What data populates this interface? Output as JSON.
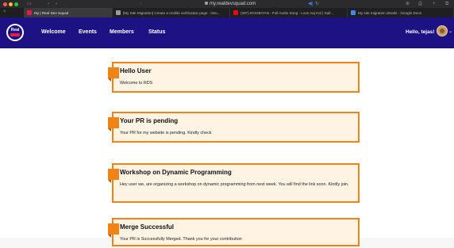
{
  "browser": {
    "url": "my.realdevsquad.com",
    "controls": [
      "‹",
      "›"
    ],
    "tabs": [
      {
        "label": "My | Real Dev Squad",
        "fav_color": "#e11d48"
      },
      {
        "label": "[My Site Migration] Create a mobile verification page - issu...",
        "fav_color": "#9a9a9e"
      },
      {
        "label": "(397) DOOBIYAN - Full Audio Song - Love Aaj Kal | Saif...",
        "fav_color": "#ff0000"
      },
      {
        "label": "My site migration details - Google Docs",
        "fav_color": "#4285f4"
      }
    ],
    "right_icons": [
      "⊕",
      "⎙",
      "+",
      "⧉"
    ]
  },
  "navbar": {
    "logo_text": "Real",
    "links": [
      "Welcome",
      "Events",
      "Members",
      "Status"
    ],
    "greeting": "Hello, tejas!",
    "accent": "#1d1283"
  },
  "cards": [
    {
      "title": "Hello User",
      "body": "Welcome to RDS"
    },
    {
      "title": "Your PR is pending",
      "body": "Your PR for my website is pending. Kindly check"
    },
    {
      "title": "Workshop on Dynamic Programming",
      "body": "Hey user we, are organizing a workshop on dynamic programming from next week. You will find the link soon. Kindly join."
    },
    {
      "title": "Merge Successful",
      "body": "Your PR is Successfully Merged. Thank you for your contribution"
    }
  ],
  "colors": {
    "card_border": "#f08316",
    "card_bg": "#fff3e3",
    "nav_bg": "#1d1283"
  }
}
